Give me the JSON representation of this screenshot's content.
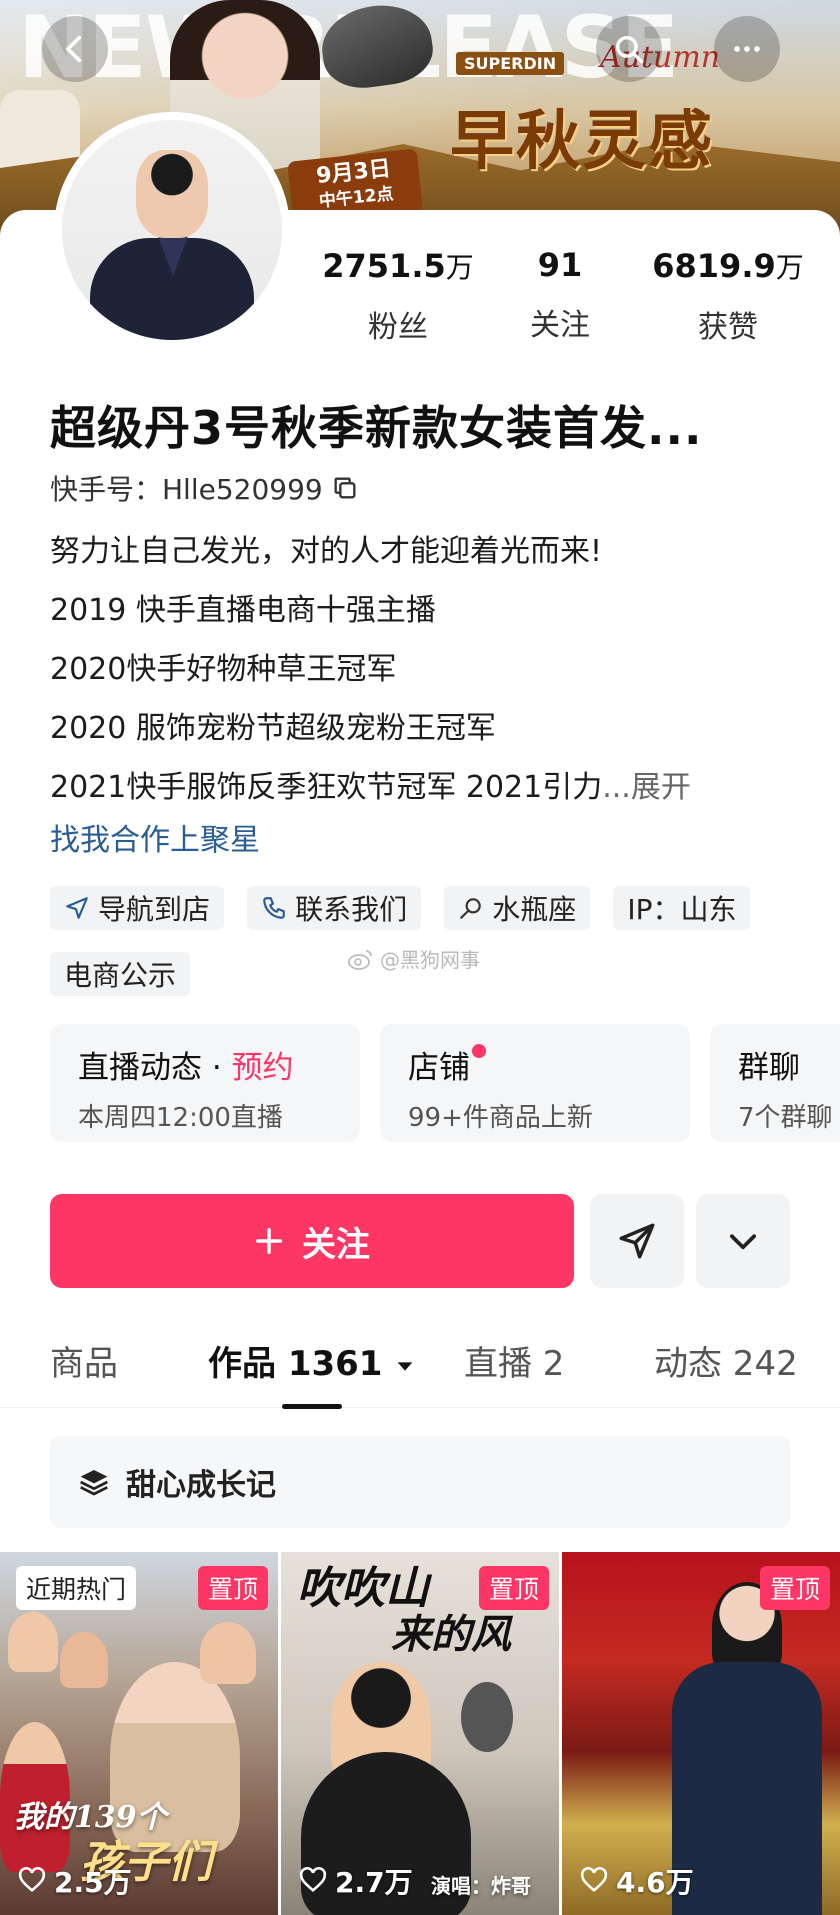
{
  "banner": {
    "big_text": "NEW RELEASE",
    "brand": "SUPERDIN",
    "autumn_word": "Autumn",
    "title": "早秋灵感",
    "date_line1": "9月3日",
    "date_line2": "中午12点"
  },
  "stats": [
    {
      "value": "2751.5",
      "unit": "万",
      "label": "粉丝"
    },
    {
      "value": "91",
      "unit": "",
      "label": "关注"
    },
    {
      "value": "6819.9",
      "unit": "万",
      "label": "获赞"
    }
  ],
  "profile": {
    "name": "超级丹3号秋季新款女装首发...",
    "uid_label": "快手号：Hlle520999",
    "bio_lines": [
      "努力让自己发光，对的人才能迎着光而来!",
      "2019 快手直播电商十强主播",
      "2020快手好物种草王冠军",
      "2020 服饰宠粉节超级宠粉王冠军",
      "2021快手服饰反季狂欢节冠军 2021引力"
    ],
    "expand_ellipsis": "...",
    "expand_label": "展开",
    "cooperate_link": "找我合作上聚星"
  },
  "tags": [
    {
      "icon": "navigation-icon",
      "label": "导航到店"
    },
    {
      "icon": "phone-icon",
      "label": "联系我们"
    },
    {
      "icon": "zodiac-icon",
      "label": "水瓶座"
    },
    {
      "icon": "",
      "label": "IP：山东"
    },
    {
      "icon": "",
      "label": "电商公示"
    }
  ],
  "watermark": "@黑狗网事",
  "features": [
    {
      "title": "直播动态 · ",
      "accent": "预约",
      "sub": "本周四12:00直播"
    },
    {
      "title": "店铺",
      "accent": "",
      "sub": "99+件商品上新"
    },
    {
      "title": "群聊",
      "accent": "",
      "sub": "7个群聊"
    }
  ],
  "actions": {
    "follow_label": "关注"
  },
  "tabs": [
    {
      "label": "商品"
    },
    {
      "label": "作品 1361"
    },
    {
      "label": "直播 2"
    },
    {
      "label": "动态 242"
    }
  ],
  "collection": {
    "label": "甜心成长记"
  },
  "videos": [
    {
      "hot": "近期热门",
      "pin": "置顶",
      "caption_a": "我的139个",
      "caption_b": "孩子们",
      "likes": "2.5万"
    },
    {
      "hot": "",
      "pin": "置顶",
      "caption_a": "吹吹山",
      "caption_b": "来的风",
      "sub": "演唱：炸哥",
      "likes": "2.7万"
    },
    {
      "hot": "",
      "pin": "置顶",
      "caption_a": "",
      "caption_b": "",
      "likes": "4.6万"
    }
  ],
  "colors": {
    "accent": "#fe3666",
    "link": "#2a5c96"
  }
}
